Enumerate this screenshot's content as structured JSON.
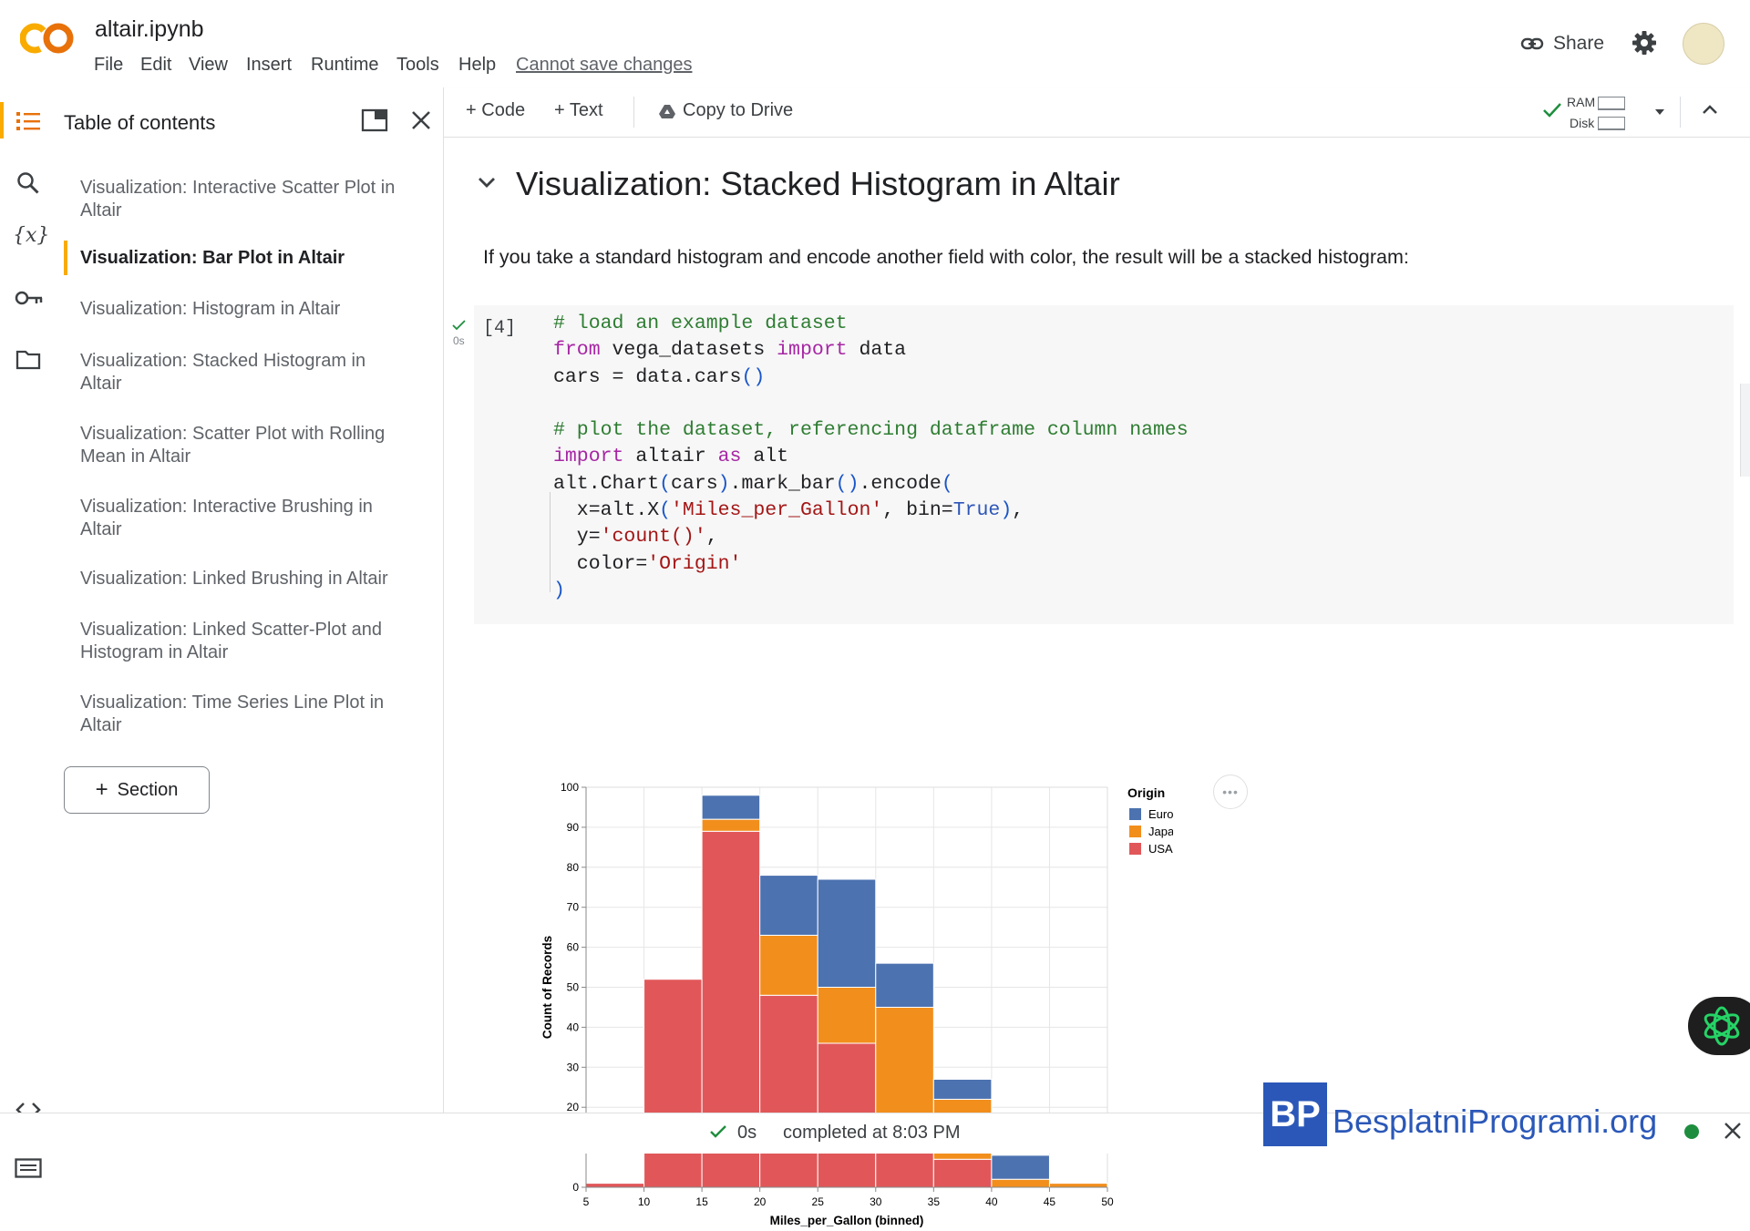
{
  "header": {
    "logo_text": "CO",
    "notebook_title": "altair.ipynb",
    "menu": [
      "File",
      "Edit",
      "View",
      "Insert",
      "Runtime",
      "Tools",
      "Help"
    ],
    "save_status": "Cannot save changes",
    "share_label": "Share"
  },
  "toolbar": {
    "code_label": "Code",
    "text_label": "Text",
    "copy_label": "Copy to Drive",
    "ram_label": "RAM",
    "disk_label": "Disk"
  },
  "toc": {
    "title": "Table of contents",
    "items": [
      {
        "label": "Visualization: Interactive Scatter Plot in Altair",
        "active": false
      },
      {
        "label": "Visualization: Bar Plot in Altair",
        "active": true
      },
      {
        "label": "Visualization: Histogram in Altair",
        "active": false
      },
      {
        "label": "Visualization: Stacked Histogram in Altair",
        "active": false
      },
      {
        "label": "Visualization: Scatter Plot with Rolling Mean in Altair",
        "active": false
      },
      {
        "label": "Visualization: Interactive Brushing in Altair",
        "active": false
      },
      {
        "label": "Visualization: Linked Brushing in Altair",
        "active": false
      },
      {
        "label": "Visualization: Linked Scatter-Plot and Histogram in Altair",
        "active": false
      },
      {
        "label": "Visualization: Time Series Line Plot in Altair",
        "active": false
      }
    ],
    "section_button": "Section"
  },
  "main": {
    "heading": "Visualization: Stacked Histogram in Altair",
    "description": "If you take a standard histogram and encode another field with color, the result will be a stacked histogram:",
    "cell": {
      "exec_count": "[4]",
      "exec_time": "0s"
    }
  },
  "colors": {
    "Europe": "#4c72b0",
    "Japan": "#f28e1c",
    "USA": "#e15759",
    "accent": "#f9ab00"
  },
  "chart_data": {
    "type": "bar",
    "stacked": true,
    "title": "",
    "xlabel": "Miles_per_Gallon (binned)",
    "ylabel": "Count of Records",
    "x_ticks": [
      5,
      10,
      15,
      20,
      25,
      30,
      35,
      40,
      45,
      50
    ],
    "y_ticks": [
      0,
      10,
      20,
      30,
      40,
      50,
      60,
      70,
      80,
      90,
      100
    ],
    "xlim": [
      5,
      50
    ],
    "ylim": [
      0,
      100
    ],
    "grid": true,
    "legend_title": "Origin",
    "legend_position": "right",
    "bins": [
      [
        5,
        10
      ],
      [
        10,
        15
      ],
      [
        15,
        20
      ],
      [
        20,
        25
      ],
      [
        25,
        30
      ],
      [
        30,
        35
      ],
      [
        35,
        40
      ],
      [
        40,
        45
      ],
      [
        45,
        50
      ]
    ],
    "series": [
      {
        "name": "USA",
        "values": [
          1,
          52,
          89,
          48,
          36,
          16,
          7,
          0,
          0
        ]
      },
      {
        "name": "Japan",
        "values": [
          0,
          0,
          3,
          15,
          14,
          29,
          15,
          2,
          1
        ]
      },
      {
        "name": "Europe",
        "values": [
          0,
          0,
          6,
          15,
          27,
          11,
          5,
          6,
          0
        ]
      }
    ]
  },
  "status": {
    "time": "0s",
    "completed": "completed at 8:03 PM"
  },
  "watermark": {
    "text": "BesplatniProgrami.org",
    "logo_text": "BP"
  }
}
